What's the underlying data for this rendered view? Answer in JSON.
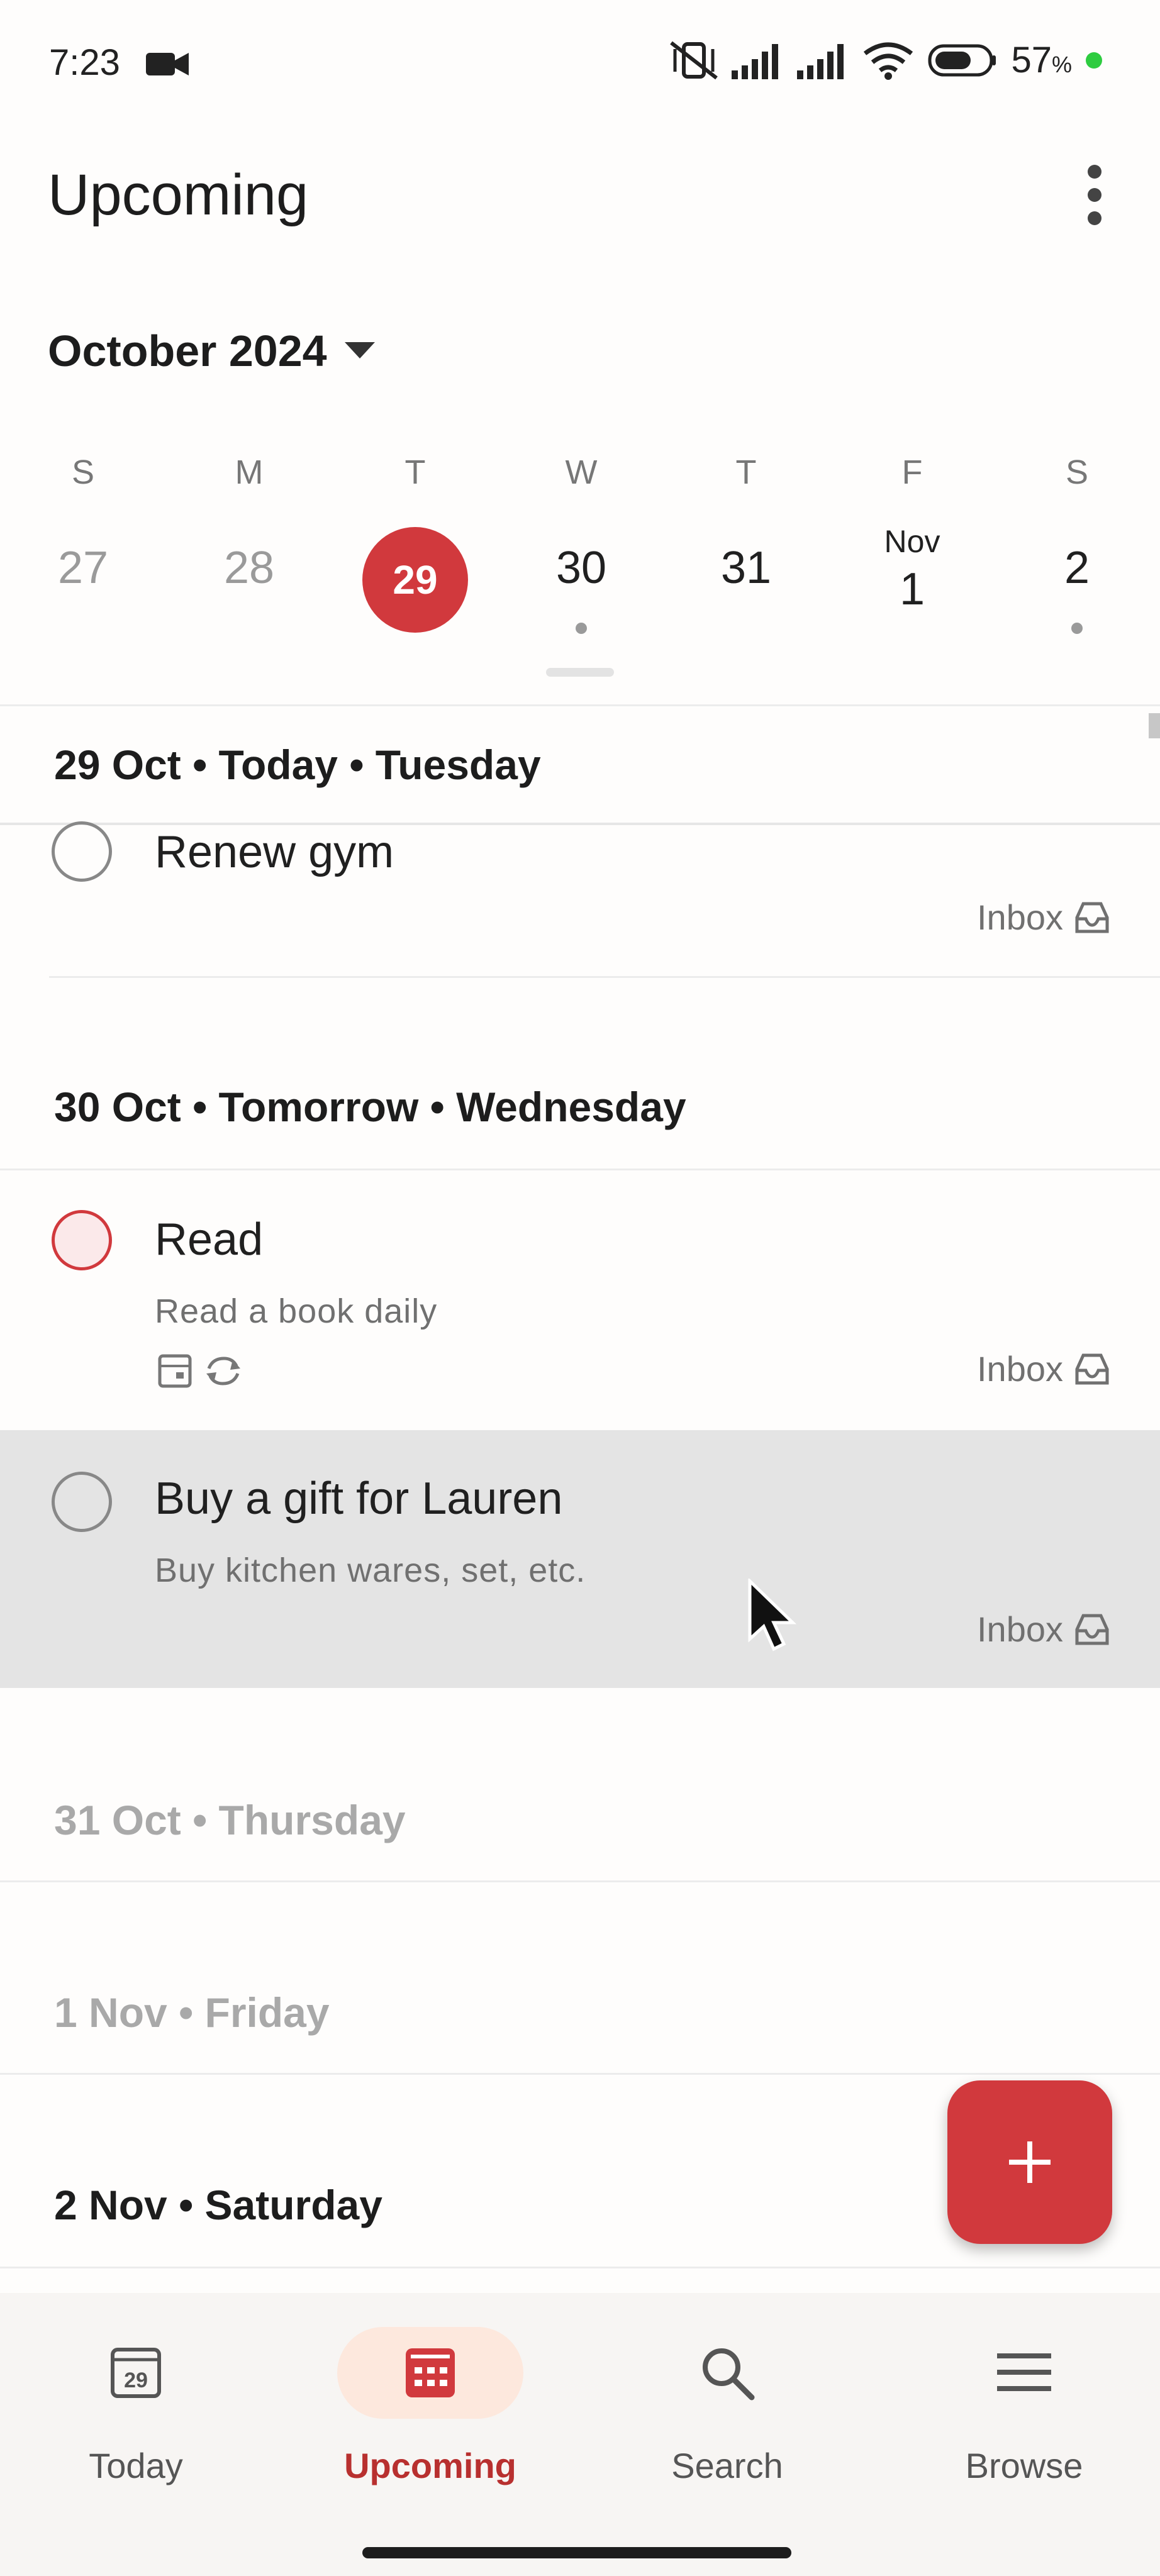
{
  "status_bar": {
    "time": "7:23",
    "battery": "57",
    "battery_unit": "%"
  },
  "header": {
    "title": "Upcoming",
    "month": "October 2024"
  },
  "week": [
    {
      "dow": "S",
      "num": "27"
    },
    {
      "dow": "M",
      "num": "28"
    },
    {
      "dow": "T",
      "num": "29"
    },
    {
      "dow": "W",
      "num": "30"
    },
    {
      "dow": "T",
      "num": "31"
    },
    {
      "dow": "F",
      "month": "Nov",
      "num": "1"
    },
    {
      "dow": "S",
      "num": "2"
    }
  ],
  "sections": [
    {
      "header": "29 Oct • Today • Tuesday",
      "tasks": [
        {
          "title": "Renew gym",
          "project": "Inbox"
        }
      ]
    },
    {
      "header": "30 Oct • Tomorrow • Wednesday",
      "tasks": [
        {
          "title": "Read",
          "description": "Read a book daily",
          "project": "Inbox"
        },
        {
          "title": "Buy a gift for Lauren",
          "description": "Buy kitchen wares, set, etc.",
          "project": "Inbox"
        }
      ]
    },
    {
      "header": "31 Oct • Thursday"
    },
    {
      "header": "1 Nov • Friday"
    },
    {
      "header": "2 Nov • Saturday"
    }
  ],
  "nav": {
    "today": "Today",
    "today_icon_day": "29",
    "upcoming": "Upcoming",
    "search": "Search",
    "browse": "Browse"
  },
  "colors": {
    "accent": "#d1393d",
    "nav_active_bg": "#fde8dd"
  },
  "icons": {
    "status": [
      "video-camera-icon",
      "mute-vibrate-icon",
      "signal-icon",
      "signal-icon",
      "wifi-icon",
      "battery-icon"
    ],
    "task_meta": [
      "calendar-icon",
      "recurring-icon"
    ],
    "project": "inbox-icon"
  }
}
